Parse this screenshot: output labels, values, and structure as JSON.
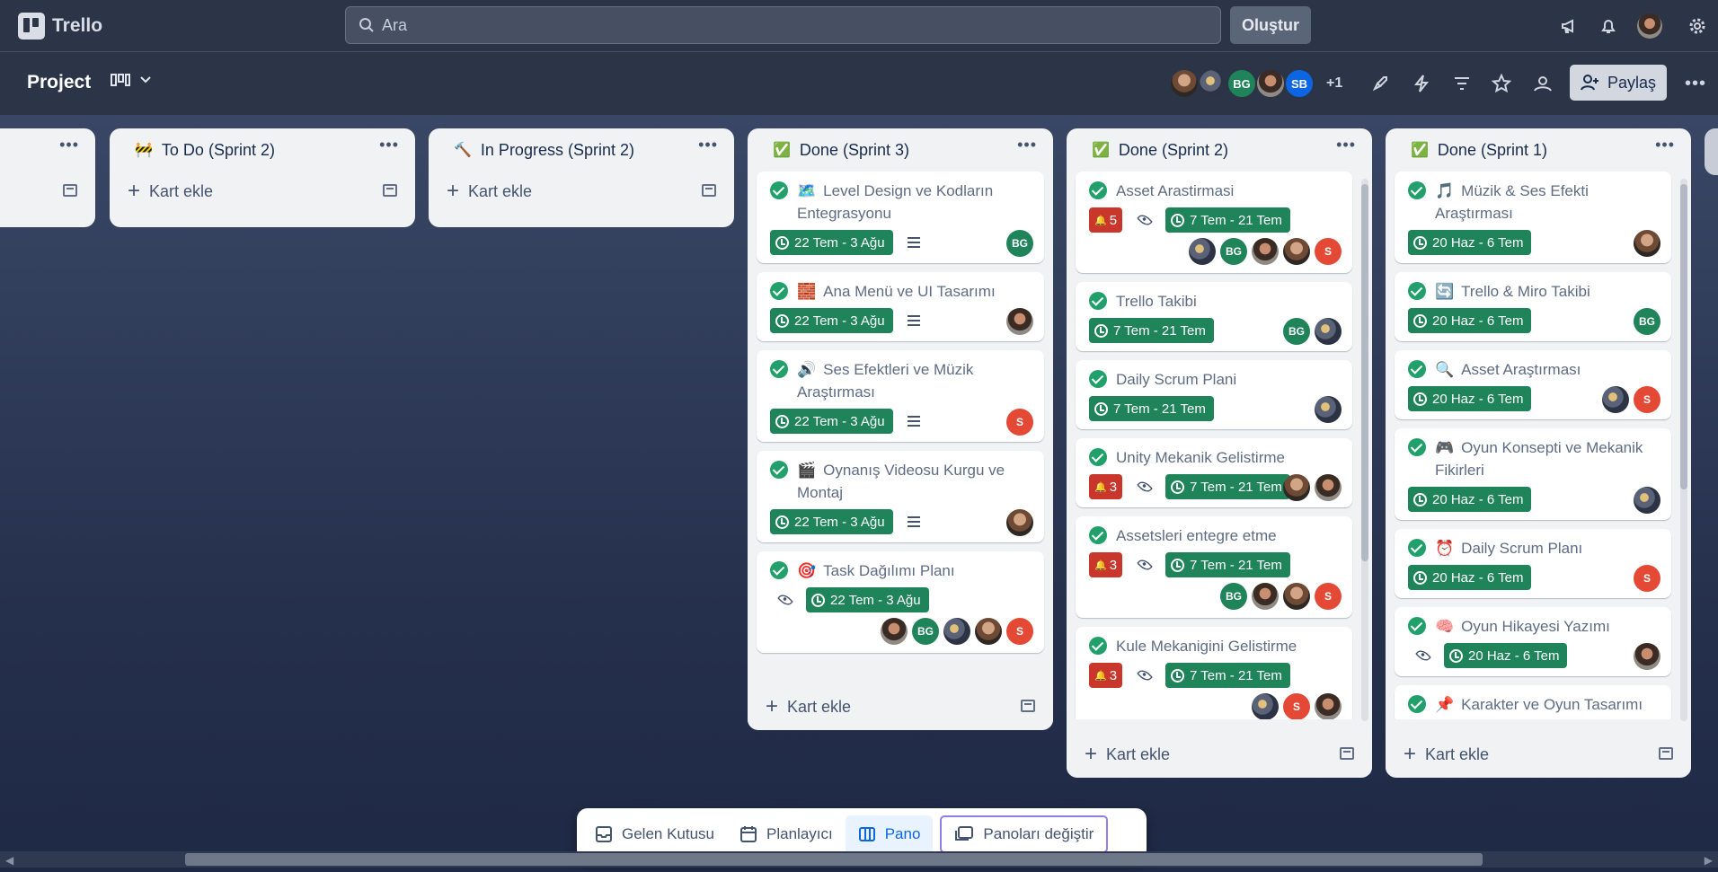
{
  "topbar": {
    "app_name": "Trello",
    "search_placeholder": "Ara",
    "create_label": "Oluştur"
  },
  "board": {
    "title": "Project",
    "members": [
      {
        "initials": "",
        "style": "photo"
      },
      {
        "initials": "",
        "style": "sports"
      },
      {
        "initials": "BG",
        "style": "bg"
      },
      {
        "initials": "",
        "style": "photo2"
      },
      {
        "initials": "SB",
        "style": "sb"
      }
    ],
    "extra_members": "+1",
    "share_label": "Paylaş"
  },
  "lists": [
    {
      "title": "",
      "emoji": "",
      "add_label": "",
      "cards": []
    },
    {
      "title": "To Do (Sprint 2)",
      "emoji": "🚧",
      "add_label": "Kart ekle",
      "cards": []
    },
    {
      "title": "In Progress (Sprint 2)",
      "emoji": "🔨",
      "add_label": "Kart ekle",
      "cards": []
    },
    {
      "title": "Done (Sprint 3)",
      "emoji": "✅",
      "add_label": "Kart ekle",
      "cards": [
        {
          "emoji": "🗺️",
          "title": "Level Design ve Kodların Entegrasyonu",
          "date": "22 Tem - 3 Ağu",
          "desc": true,
          "members": [
            "bg:BG"
          ]
        },
        {
          "emoji": "🧱",
          "title": "Ana Menü ve UI Tasarımı",
          "date": "22 Tem - 3 Ağu",
          "desc": true,
          "members": [
            "photo2:"
          ]
        },
        {
          "emoji": "🔊",
          "title": "Ses Efektleri ve Müzik Araştırması",
          "date": "22 Tem - 3 Ağu",
          "desc": true,
          "members": [
            "s:S"
          ]
        },
        {
          "emoji": "🎬",
          "title": "Oynanış Videosu Kurgu ve Montaj",
          "date": "22 Tem - 3 Ağu",
          "desc": true,
          "members": [
            "photo:"
          ]
        },
        {
          "emoji": "🎯",
          "title": "Task Dağılımı Planı",
          "date": "22 Tem - 3 Ağu",
          "watch": true,
          "members_row": [
            "photo2:",
            "bg:BG",
            "sports:",
            "photo:",
            "s:S"
          ]
        }
      ]
    },
    {
      "title": "Done (Sprint 2)",
      "emoji": "✅",
      "add_label": "Kart ekle",
      "cards": [
        {
          "emoji": "",
          "title": "Asset Arastirmasi",
          "bell": "5",
          "watch": true,
          "date": "7 Tem - 21 Tem",
          "members_row": [
            "sports:",
            "bg:BG",
            "photo2:",
            "photo:",
            "s:S"
          ]
        },
        {
          "emoji": "",
          "title": "Trello Takibi",
          "date": "7 Tem - 21 Tem",
          "members": [
            "bg:BG",
            "sports:"
          ]
        },
        {
          "emoji": "",
          "title": "Daily Scrum Plani",
          "date": "7 Tem - 21 Tem",
          "members": [
            "sports:"
          ]
        },
        {
          "emoji": "",
          "title": "Unity Mekanik Gelistirme",
          "bell": "3",
          "watch": true,
          "date": "7 Tem - 21 Tem",
          "members": [
            "photo:",
            "photo2:"
          ]
        },
        {
          "emoji": "",
          "title": "Assetsleri entegre etme",
          "bell": "3",
          "watch": true,
          "date": "7 Tem - 21 Tem",
          "members_row": [
            "bg:BG",
            "photo2:",
            "photo:",
            "s:S"
          ]
        },
        {
          "emoji": "",
          "title": "Kule Mekanigini Gelistirme",
          "bell": "3",
          "watch": true,
          "date": "7 Tem - 21 Tem",
          "members_row": [
            "sports:",
            "s:S",
            "photo2:"
          ]
        }
      ]
    },
    {
      "title": "Done (Sprint 1)",
      "emoji": "✅",
      "add_label": "Kart ekle",
      "cards": [
        {
          "emoji": "🎵",
          "title": "Müzik & Ses Efekti Araştırması",
          "date": "20 Haz - 6 Tem",
          "members": [
            "photo:"
          ]
        },
        {
          "emoji": "🔄",
          "title": "Trello & Miro Takibi",
          "date": "20 Haz - 6 Tem",
          "members": [
            "bg:BG"
          ]
        },
        {
          "emoji": "🔍",
          "title": "Asset Araştırması",
          "date": "20 Haz - 6 Tem",
          "members": [
            "sports:",
            "s:S"
          ]
        },
        {
          "emoji": "🎮",
          "title": "Oyun Konsepti ve Mekanik Fikirleri",
          "date": "20 Haz - 6 Tem",
          "members": [
            "sports:"
          ]
        },
        {
          "emoji": "⏰",
          "title": "Daily Scrum Planı",
          "date": "20 Haz - 6 Tem",
          "members": [
            "s:S"
          ]
        },
        {
          "emoji": "🧠",
          "title": "Oyun Hikayesi Yazımı",
          "watch": true,
          "date": "20 Haz - 6 Tem",
          "members": [
            "photo2:"
          ]
        },
        {
          "emoji": "📌",
          "title": "Karakter ve Oyun Tasarımı",
          "date": "",
          "members": []
        }
      ]
    }
  ],
  "bottom_nav": {
    "inbox": "Gelen Kutusu",
    "planner": "Planlayıcı",
    "board": "Pano",
    "switch_boards": "Panoları değiştir"
  }
}
